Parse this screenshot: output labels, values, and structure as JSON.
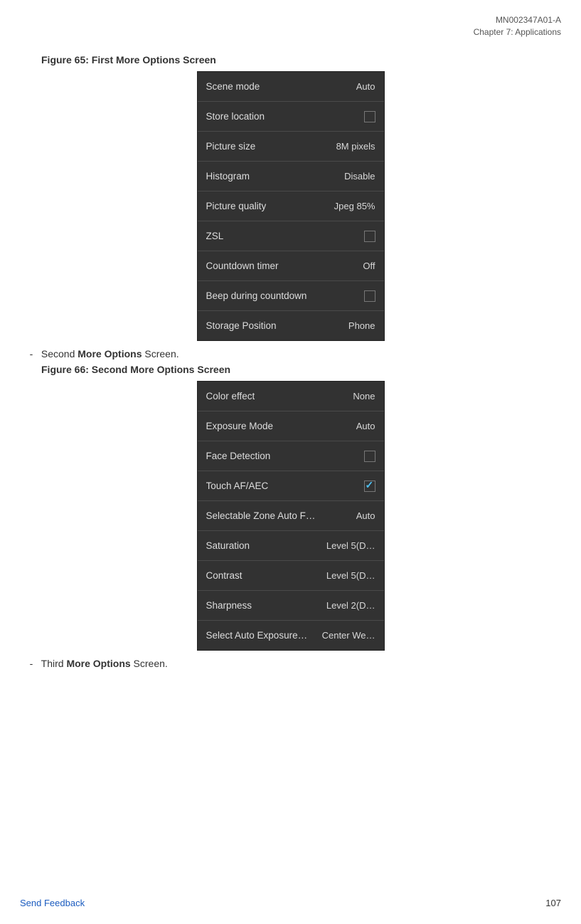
{
  "header": {
    "doc_id": "MN002347A01-A",
    "chapter": "Chapter 7:  Applications"
  },
  "figure1": {
    "title": "Figure 65: First More Options Screen",
    "rows": [
      {
        "label": "Scene mode",
        "value": "Auto",
        "type": "text"
      },
      {
        "label": "Store location",
        "type": "checkbox",
        "checked": false
      },
      {
        "label": "Picture size",
        "value": "8M pixels",
        "type": "text"
      },
      {
        "label": "Histogram",
        "value": "Disable",
        "type": "text"
      },
      {
        "label": "Picture quality",
        "value": "Jpeg 85%",
        "type": "text"
      },
      {
        "label": "ZSL",
        "type": "checkbox",
        "checked": false
      },
      {
        "label": "Countdown timer",
        "value": "Off",
        "type": "text"
      },
      {
        "label": "Beep during countdown",
        "type": "checkbox",
        "checked": false
      },
      {
        "label": "Storage Position",
        "value": "Phone",
        "type": "text"
      }
    ]
  },
  "bullet1": {
    "prefix": "Second ",
    "bold": "More Options",
    "suffix": " Screen."
  },
  "figure2": {
    "title": "Figure 66: Second More Options Screen",
    "rows": [
      {
        "label": "Color effect",
        "value": "None",
        "type": "text"
      },
      {
        "label": "Exposure Mode",
        "value": "Auto",
        "type": "text"
      },
      {
        "label": "Face Detection",
        "type": "checkbox",
        "checked": false
      },
      {
        "label": "Touch AF/AEC",
        "type": "checkbox",
        "checked": true
      },
      {
        "label": "Selectable Zone Auto F…",
        "value": "Auto",
        "type": "text"
      },
      {
        "label": "Saturation",
        "value": "Level 5(D…",
        "type": "text"
      },
      {
        "label": "Contrast",
        "value": "Level 5(D…",
        "type": "text"
      },
      {
        "label": "Sharpness",
        "value": "Level 2(D…",
        "type": "text"
      },
      {
        "label": "Select Auto Exposure…",
        "value": "Center We…",
        "type": "text"
      }
    ]
  },
  "bullet2": {
    "prefix": "Third ",
    "bold": "More Options",
    "suffix": " Screen."
  },
  "footer": {
    "link": "Send Feedback",
    "page": "107"
  }
}
